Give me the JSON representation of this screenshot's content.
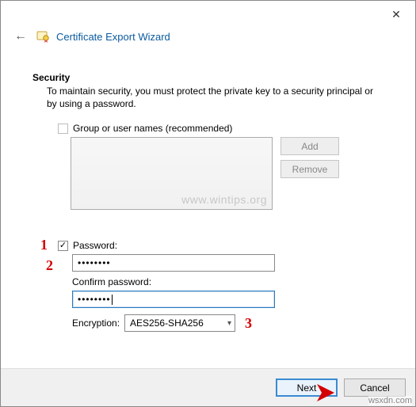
{
  "titlebar": {
    "close_glyph": "✕"
  },
  "header": {
    "back_glyph": "←",
    "wizard_title": "Certificate Export Wizard"
  },
  "security": {
    "heading": "Security",
    "description": "To maintain security, you must protect the private key to a security principal or by using a password.",
    "group_label": "Group or user names (recommended)",
    "add_label": "Add",
    "remove_label": "Remove",
    "watermark": "www.wintips.org"
  },
  "password": {
    "checkbox_label": "Password:",
    "value_masked": "••••••••",
    "confirm_label": "Confirm password:",
    "confirm_value_masked": "••••••••",
    "encryption_label": "Encryption:",
    "encryption_value": "AES256-SHA256"
  },
  "annotations": {
    "a1": "1",
    "a2": "2",
    "a3": "3"
  },
  "footer": {
    "next": "Next",
    "cancel": "Cancel"
  },
  "attribution": "wsxdn.com"
}
